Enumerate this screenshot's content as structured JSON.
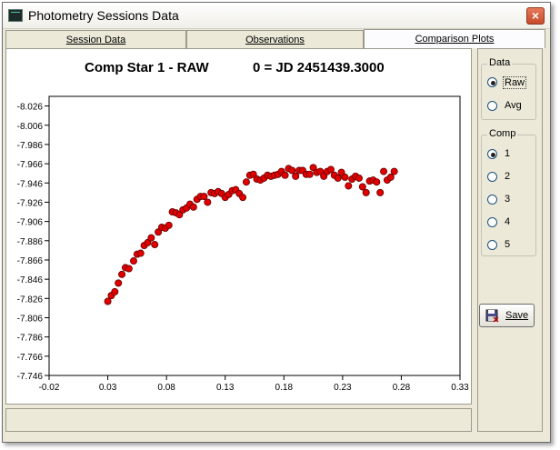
{
  "window": {
    "title": "Photometry Sessions Data",
    "close_glyph": "×"
  },
  "tabs": [
    {
      "label": "Session Data"
    },
    {
      "label": "Observations"
    },
    {
      "label": "Comparison Plots"
    }
  ],
  "chart": {
    "title": "Comp Star 1 - RAW",
    "subtitle": "0 = JD 2451439.3000"
  },
  "chart_data": {
    "type": "scatter",
    "title": "Comp Star 1 - RAW",
    "annotation": "0 = JD 2451439.3000",
    "xlabel": "",
    "ylabel": "",
    "x_ticks": [
      "-0.02",
      "0.03",
      "0.08",
      "0.13",
      "0.18",
      "0.23",
      "0.28",
      "0.33"
    ],
    "y_ticks": [
      "-8.026",
      "-8.006",
      "-7.986",
      "-7.966",
      "-7.946",
      "-7.926",
      "-7.906",
      "-7.886",
      "-7.866",
      "-7.846",
      "-7.826",
      "-7.806",
      "-7.786",
      "-7.766",
      "-7.746"
    ],
    "xlim": [
      -0.02,
      0.33
    ],
    "ylim": [
      -8.036,
      -7.746
    ],
    "y_inverted": true,
    "grid": false,
    "point_color": "#e00000",
    "series": [
      {
        "points": [
          [
            0.03,
            -7.823
          ],
          [
            0.033,
            -7.829
          ],
          [
            0.036,
            -7.833
          ],
          [
            0.039,
            -7.842
          ],
          [
            0.042,
            -7.851
          ],
          [
            0.045,
            -7.858
          ],
          [
            0.048,
            -7.857
          ],
          [
            0.052,
            -7.865
          ],
          [
            0.055,
            -7.872
          ],
          [
            0.058,
            -7.873
          ],
          [
            0.061,
            -7.881
          ],
          [
            0.064,
            -7.884
          ],
          [
            0.067,
            -7.889
          ],
          [
            0.07,
            -7.882
          ],
          [
            0.073,
            -7.895
          ],
          [
            0.076,
            -7.9
          ],
          [
            0.079,
            -7.899
          ],
          [
            0.082,
            -7.902
          ],
          [
            0.085,
            -7.916
          ],
          [
            0.088,
            -7.915
          ],
          [
            0.091,
            -7.913
          ],
          [
            0.094,
            -7.918
          ],
          [
            0.097,
            -7.92
          ],
          [
            0.1,
            -7.924
          ],
          [
            0.103,
            -7.921
          ],
          [
            0.106,
            -7.929
          ],
          [
            0.109,
            -7.932
          ],
          [
            0.112,
            -7.932
          ],
          [
            0.115,
            -7.926
          ],
          [
            0.118,
            -7.936
          ],
          [
            0.121,
            -7.935
          ],
          [
            0.124,
            -7.937
          ],
          [
            0.127,
            -7.935
          ],
          [
            0.13,
            -7.931
          ],
          [
            0.133,
            -7.934
          ],
          [
            0.136,
            -7.938
          ],
          [
            0.139,
            -7.939
          ],
          [
            0.142,
            -7.935
          ],
          [
            0.145,
            -7.931
          ],
          [
            0.148,
            -7.947
          ],
          [
            0.151,
            -7.954
          ],
          [
            0.154,
            -7.955
          ],
          [
            0.157,
            -7.95
          ],
          [
            0.16,
            -7.949
          ],
          [
            0.163,
            -7.951
          ],
          [
            0.166,
            -7.954
          ],
          [
            0.169,
            -7.953
          ],
          [
            0.172,
            -7.954
          ],
          [
            0.175,
            -7.955
          ],
          [
            0.178,
            -7.958
          ],
          [
            0.181,
            -7.954
          ],
          [
            0.184,
            -7.961
          ],
          [
            0.187,
            -7.959
          ],
          [
            0.19,
            -7.953
          ],
          [
            0.193,
            -7.959
          ],
          [
            0.196,
            -7.959
          ],
          [
            0.199,
            -7.955
          ],
          [
            0.202,
            -7.955
          ],
          [
            0.205,
            -7.962
          ],
          [
            0.208,
            -7.957
          ],
          [
            0.211,
            -7.958
          ],
          [
            0.214,
            -7.953
          ],
          [
            0.217,
            -7.958
          ],
          [
            0.22,
            -7.96
          ],
          [
            0.223,
            -7.954
          ],
          [
            0.226,
            -7.951
          ],
          [
            0.229,
            -7.957
          ],
          [
            0.232,
            -7.952
          ],
          [
            0.235,
            -7.943
          ],
          [
            0.238,
            -7.95
          ],
          [
            0.241,
            -7.953
          ],
          [
            0.244,
            -7.951
          ],
          [
            0.247,
            -7.942
          ],
          [
            0.25,
            -7.936
          ],
          [
            0.253,
            -7.948
          ],
          [
            0.256,
            -7.949
          ],
          [
            0.259,
            -7.947
          ],
          [
            0.262,
            -7.936
          ],
          [
            0.265,
            -7.958
          ],
          [
            0.268,
            -7.949
          ],
          [
            0.271,
            -7.952
          ],
          [
            0.274,
            -7.958
          ]
        ]
      }
    ]
  },
  "data_group": {
    "title": "Data",
    "options": [
      {
        "label": "Raw",
        "selected": true
      },
      {
        "label": "Avg",
        "selected": false
      }
    ]
  },
  "comp_group": {
    "title": "Comp",
    "options": [
      {
        "label": "1",
        "selected": true
      },
      {
        "label": "2",
        "selected": false
      },
      {
        "label": "3",
        "selected": false
      },
      {
        "label": "4",
        "selected": false
      },
      {
        "label": "5",
        "selected": false
      }
    ]
  },
  "save_button": {
    "label": "Save"
  },
  "status": {
    "text": ""
  }
}
